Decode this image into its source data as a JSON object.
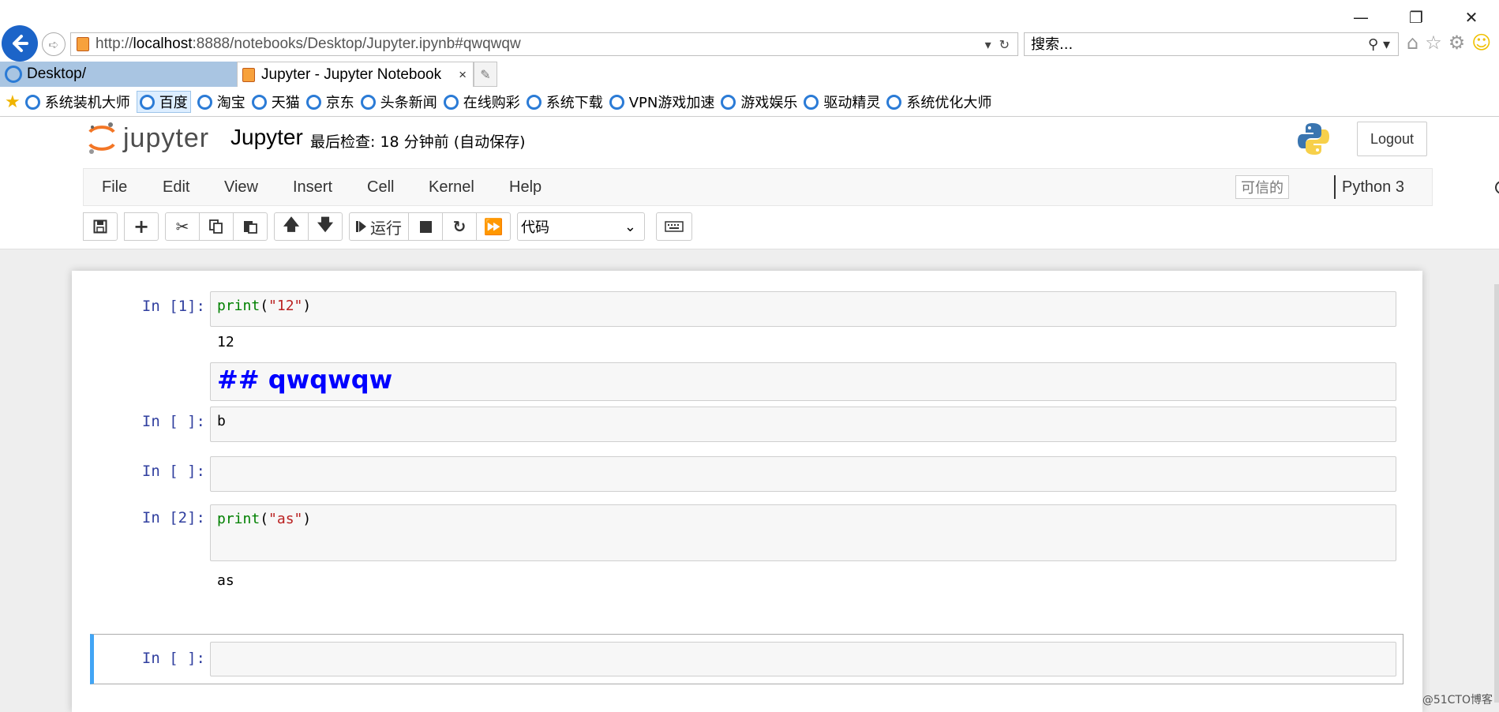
{
  "browser": {
    "window_controls": [
      "—",
      "❐",
      "✕"
    ],
    "address": {
      "url_prefix": "http://",
      "url_host": "localhost",
      "url_rest": ":8888/notebooks/Desktop/Jupyter.ipynb#qwqwqw"
    },
    "search_placeholder": "搜索...",
    "tabs": [
      {
        "label": "Desktop/"
      },
      {
        "label": "Jupyter - Jupyter Notebook",
        "close": "×"
      }
    ],
    "favorites": [
      "系统装机大师",
      "百度",
      "淘宝",
      "天猫",
      "京东",
      "头条新闻",
      "在线购彩",
      "系统下载",
      "VPN游戏加速",
      "游戏娱乐",
      "驱动精灵",
      "系统优化大师"
    ]
  },
  "jupyter": {
    "logo_text": "jupyter",
    "notebook_name": "Jupyter",
    "checkpoint": "最后检查: 18 分钟前  (自动保存)",
    "logout": "Logout",
    "menu": [
      "File",
      "Edit",
      "View",
      "Insert",
      "Cell",
      "Kernel",
      "Help"
    ],
    "trusted": "可信的",
    "kernel_name": "Python 3",
    "toolbar": {
      "run_label": "运行",
      "cell_type": "代码"
    }
  },
  "cells": [
    {
      "prompt": "In [1]:",
      "code_func": "print",
      "code_paren_open": "(",
      "code_str": "\"12\"",
      "code_paren_close": ")",
      "output": "12"
    },
    {
      "markdown": "## qwqwqw"
    },
    {
      "prompt": "In [ ]:",
      "code": "b"
    },
    {
      "prompt": "In [ ]:",
      "code": ""
    },
    {
      "prompt": "In [2]:",
      "code_func": "print",
      "code_paren_open": "(",
      "code_str": "\"as\"",
      "code_paren_close": ")",
      "output": "as"
    },
    {
      "prompt": "In [ ]:",
      "code": ""
    }
  ],
  "watermark": "@51CTO博客",
  "colors": {
    "prompt": "#303f9f",
    "keyword": "#008000",
    "string": "#ba2121",
    "markdown_heading": "#0000ff",
    "selected_cell_bar": "#42a5f5",
    "jupyter_orange": "#f37626"
  }
}
